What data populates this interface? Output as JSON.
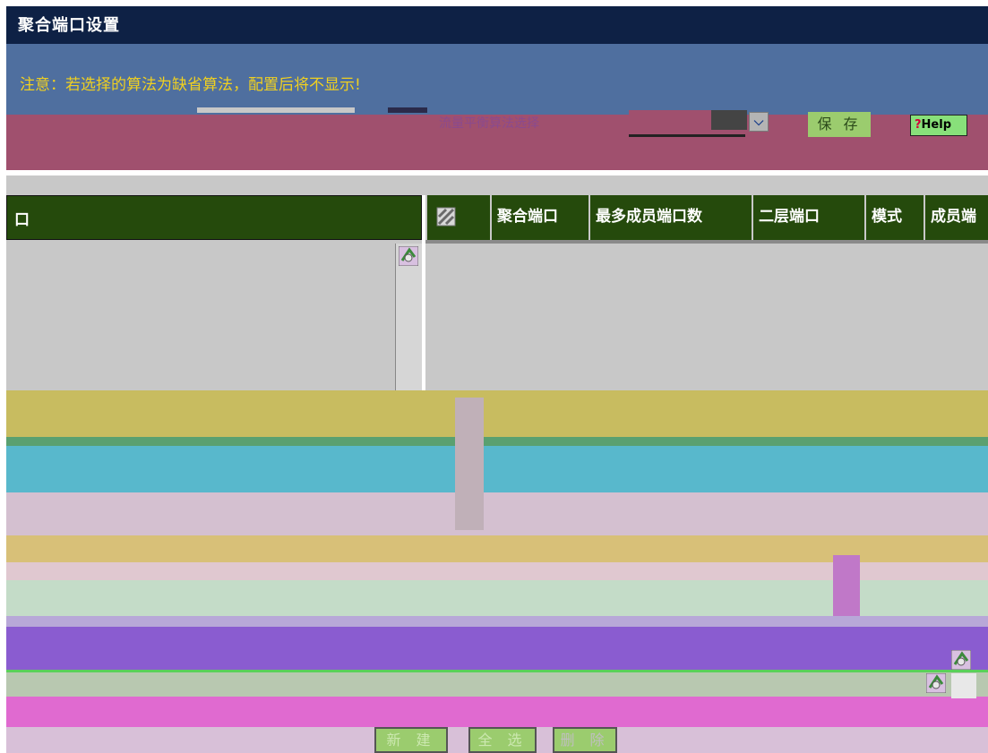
{
  "title": "聚合端口设置",
  "notice": "注意：若选择的算法为缺省算法，配置后将不显示!",
  "toolbar": {
    "algorithm_label": "流量平衡算法选择",
    "save_label": "保 存",
    "help_label": "Help",
    "help_mark": "?"
  },
  "left_table": {
    "header": "口"
  },
  "right_table": {
    "columns": [
      "聚合端口",
      "最多成员端口数",
      "二层端口",
      "模式",
      "成员端"
    ]
  },
  "footer": {
    "new_label": "新 建",
    "select_all_label": "全 选",
    "delete_label": "删 除"
  },
  "colors": {
    "title_bar": "#0e2145",
    "header_green": "#254a0c",
    "button_green": "#9bcc6e",
    "notice_text": "#f0d020"
  }
}
